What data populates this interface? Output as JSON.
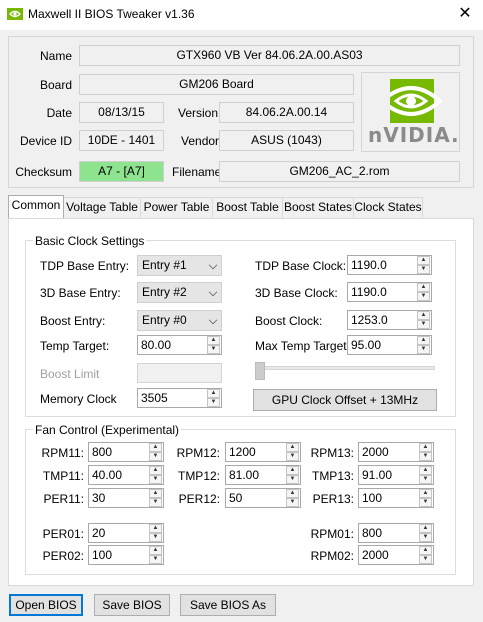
{
  "window": {
    "title": "Maxwell II BIOS Tweaker v1.36",
    "close_glyph": "✕"
  },
  "header": {
    "name_label": "Name",
    "name_value": "GTX960 VB Ver 84.06.2A.00.AS03",
    "board_label": "Board",
    "board_value": "GM206 Board",
    "date_label": "Date",
    "date_value": "08/13/15",
    "version_label": "Version",
    "version_value": "84.06.2A.00.14",
    "device_id_label": "Device ID",
    "device_id_value": "10DE - 1401",
    "vendor_label": "Vendor",
    "vendor_value": "ASUS (1043)",
    "checksum_label": "Checksum",
    "checksum_value": "A7 - [A7]",
    "filename_label": "Filename",
    "filename_value": "GM206_AC_2.rom",
    "logo_text": "nVIDIA."
  },
  "tabs": [
    "Common",
    "Voltage Table",
    "Power Table",
    "Boost Table",
    "Boost States",
    "Clock States"
  ],
  "basic_clock": {
    "title": "Basic Clock Settings",
    "tdp_entry_label": "TDP Base Entry:",
    "tdp_entry_value": "Entry #1",
    "d3_entry_label": "3D Base Entry:",
    "d3_entry_value": "Entry #2",
    "boost_entry_label": "Boost Entry:",
    "boost_entry_value": "Entry #0",
    "temp_target_label": "Temp Target:",
    "temp_target_value": "80.00",
    "boost_limit_label": "Boost Limit",
    "boost_limit_value": "",
    "memory_clock_label": "Memory Clock",
    "memory_clock_value": "3505",
    "tdp_clock_label": "TDP Base Clock:",
    "tdp_clock_value": "1190.0",
    "d3_clock_label": "3D Base Clock:",
    "d3_clock_value": "1190.0",
    "boost_clock_label": "Boost Clock:",
    "boost_clock_value": "1253.0",
    "max_temp_label": "Max Temp Target:",
    "max_temp_value": "95.00",
    "offset_button": "GPU Clock Offset + 13MHz",
    "offset_slider_level": 0.0
  },
  "fan_control": {
    "title": "Fan Control (Experimental)",
    "rpm11_label": "RPM11:",
    "rpm11_value": "800",
    "rpm12_label": "RPM12:",
    "rpm12_value": "1200",
    "rpm13_label": "RPM13:",
    "rpm13_value": "2000",
    "tmp11_label": "TMP11:",
    "tmp11_value": "40.00",
    "tmp12_label": "TMP12:",
    "tmp12_value": "81.00",
    "tmp13_label": "TMP13:",
    "tmp13_value": "91.00",
    "per11_label": "PER11:",
    "per11_value": "30",
    "per12_label": "PER12:",
    "per12_value": "50",
    "per13_label": "PER13:",
    "per13_value": "100",
    "per01_label": "PER01:",
    "per01_value": "20",
    "per02_label": "PER02:",
    "per02_value": "100",
    "rpm01_label": "RPM01:",
    "rpm01_value": "800",
    "rpm02_label": "RPM02:",
    "rpm02_value": "2000"
  },
  "footer": {
    "open_bios": "Open BIOS",
    "save_bios": "Save BIOS",
    "save_bios_as": "Save BIOS As"
  },
  "spin_glyphs": {
    "up": "▲",
    "down": "▼"
  },
  "colors": {
    "checksum_ok": "#8ee38e",
    "nvidia_green": "#76b900",
    "focus_blue": "#0078d7"
  }
}
